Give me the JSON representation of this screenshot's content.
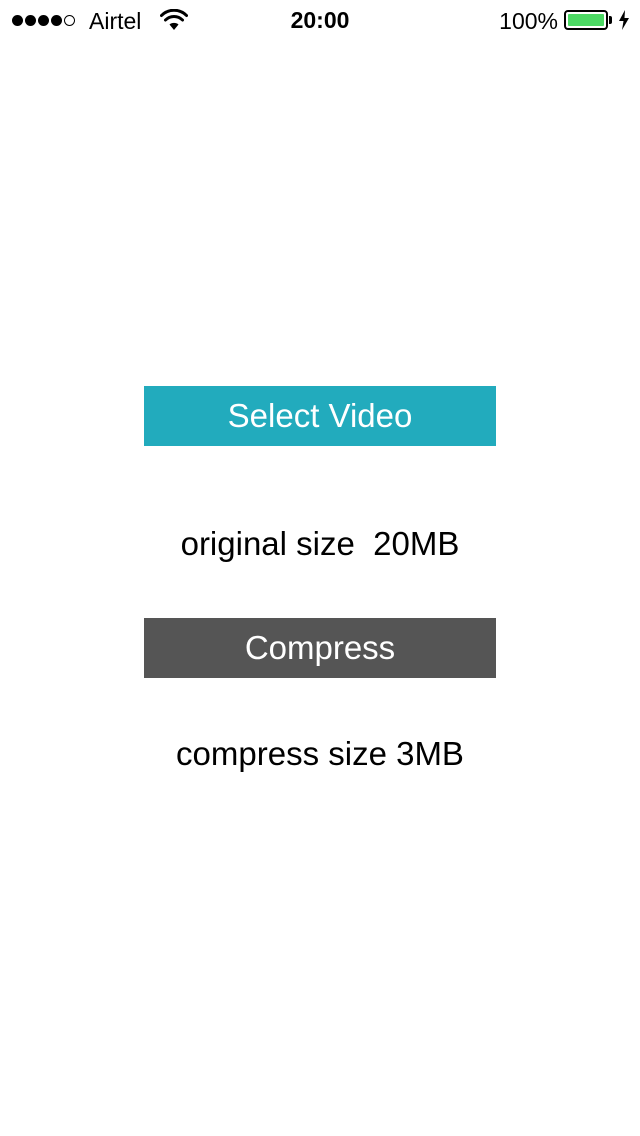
{
  "status_bar": {
    "signal_bars_filled": 4,
    "signal_bars_total": 5,
    "signal_icon": "signal-strength-icon",
    "carrier": "Airtel",
    "wifi_icon": "wifi-icon",
    "time": "20:00",
    "battery_percent": "100%",
    "battery_level": 1.0,
    "battery_icon": "battery-icon",
    "charging_icon": "charging-bolt-icon"
  },
  "main": {
    "select_video_label": "Select Video",
    "original_size_text": "original size  20MB",
    "compress_label": "Compress",
    "compressed_size_text": "compress size 3MB"
  },
  "colors": {
    "select_button": "#22abbd",
    "compress_button": "#555555",
    "battery_fill": "#4cd964"
  }
}
